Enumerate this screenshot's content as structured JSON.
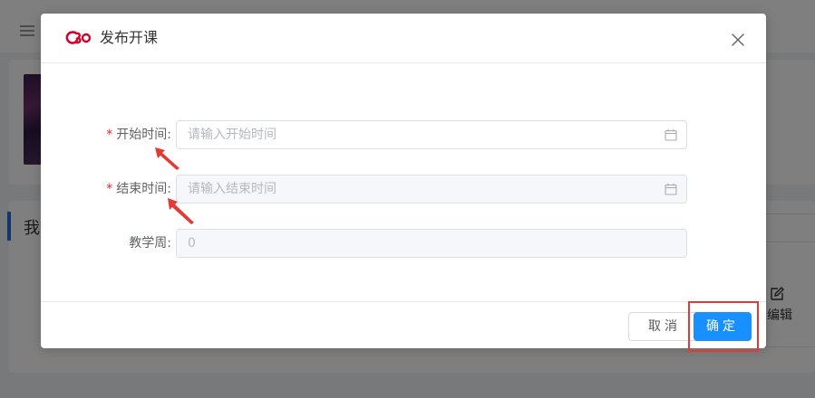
{
  "background": {
    "section_title": "我",
    "edit_label": "编辑"
  },
  "modal": {
    "title": "发布开课",
    "fields": [
      {
        "label": "开始时间:",
        "required": true,
        "placeholder": "请输入开始时间",
        "value": "",
        "disabled": false,
        "icon": "calendar-icon"
      },
      {
        "label": "结束时间:",
        "required": true,
        "placeholder": "请输入结束时间",
        "value": "",
        "disabled": true,
        "icon": "calendar-icon"
      },
      {
        "label": "教学周:",
        "required": false,
        "placeholder": "0",
        "value": "",
        "disabled": true,
        "icon": ""
      }
    ],
    "required_mark": "*",
    "cancel_label": "取消",
    "ok_label": "确定"
  },
  "colors": {
    "primary": "#1890ff",
    "required": "#f5222d",
    "annotation": "#e53935",
    "brand_logo": "#d6002a"
  }
}
